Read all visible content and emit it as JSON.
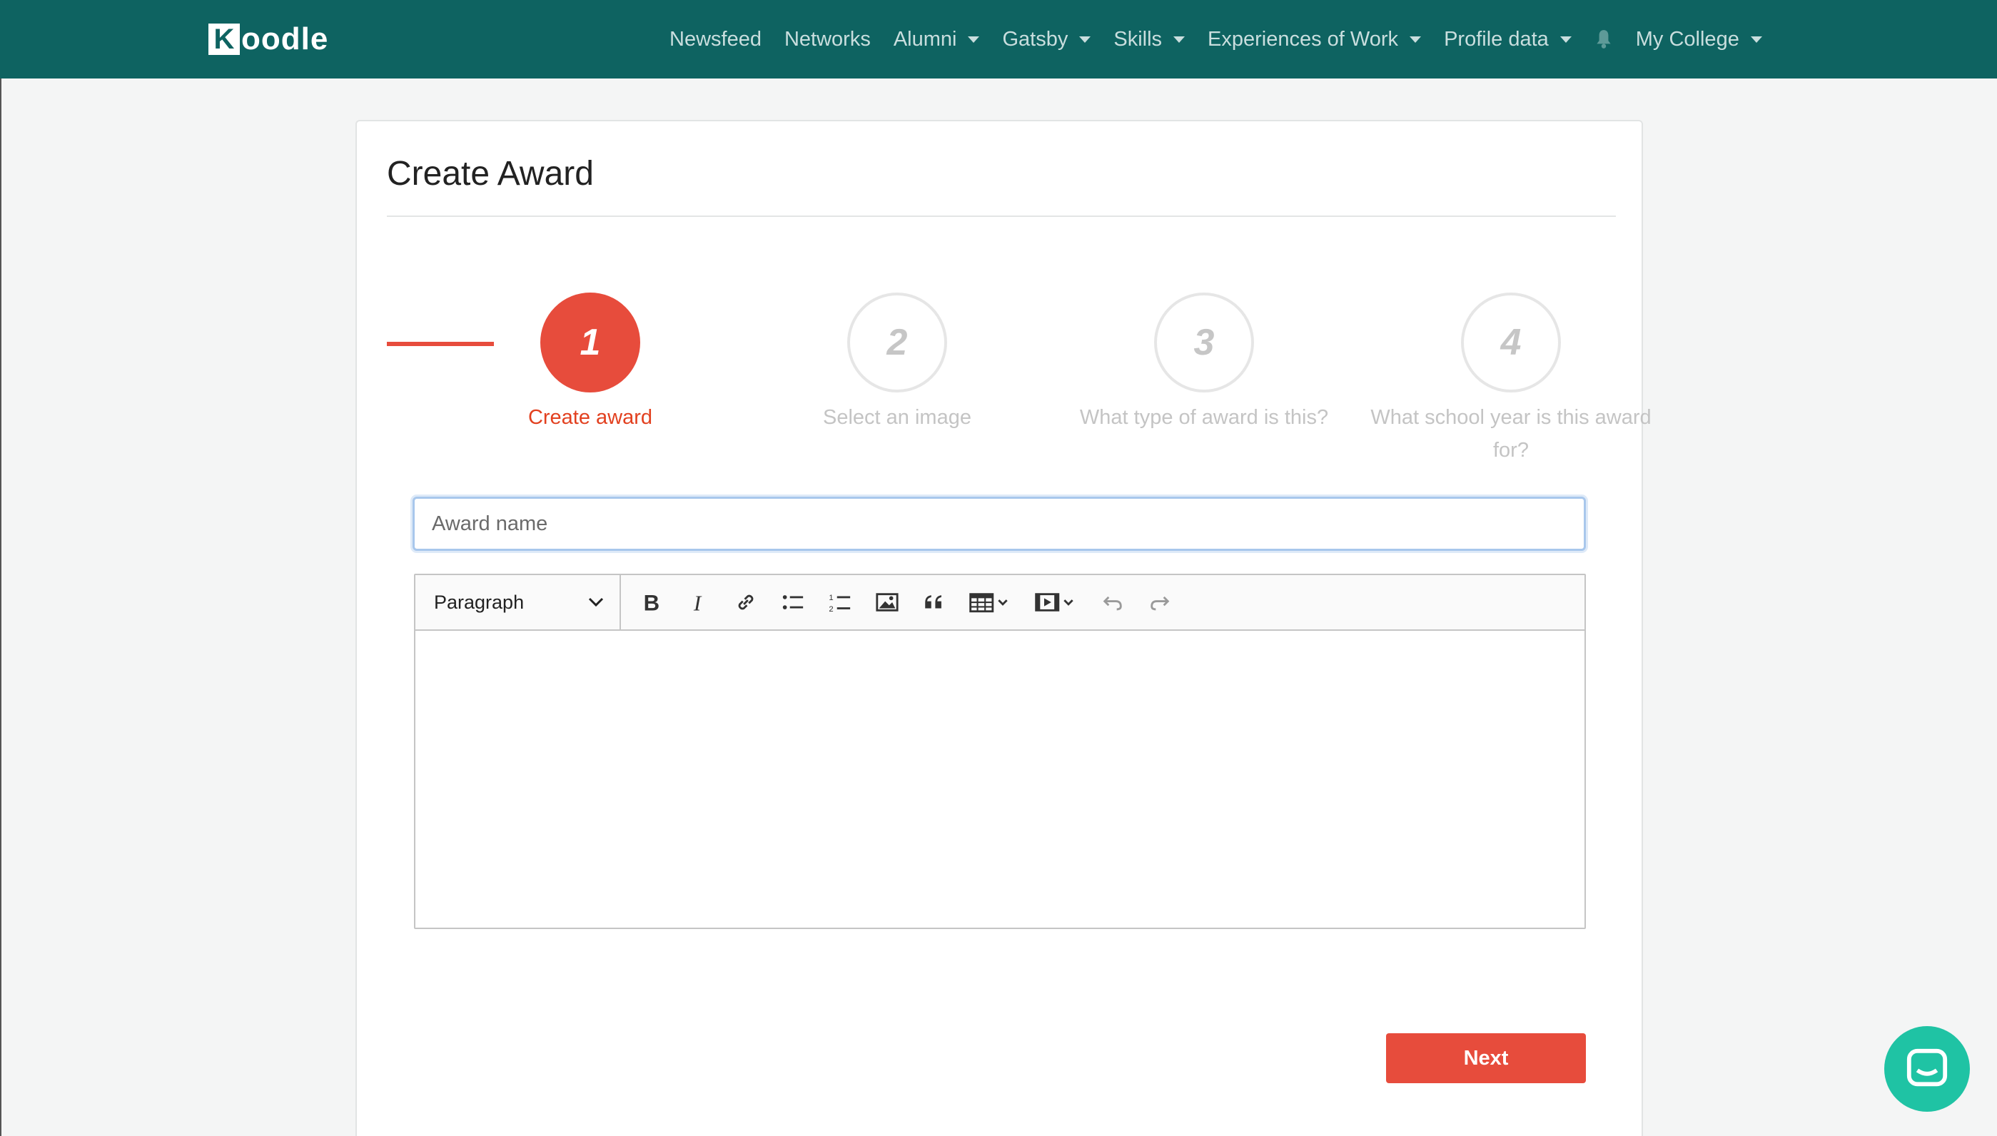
{
  "navbar": {
    "logo_letter": "K",
    "logo_rest": "oodle",
    "items": [
      {
        "label": "Newsfeed",
        "dropdown": false
      },
      {
        "label": "Networks",
        "dropdown": false
      },
      {
        "label": "Alumni",
        "dropdown": true
      },
      {
        "label": "Gatsby",
        "dropdown": true
      },
      {
        "label": "Skills",
        "dropdown": true
      },
      {
        "label": "Experiences of Work",
        "dropdown": true
      },
      {
        "label": "Profile data",
        "dropdown": true
      }
    ],
    "notifications_icon": "bell-icon",
    "college_menu": "My College"
  },
  "page": {
    "title": "Create Award"
  },
  "stepper": {
    "steps": [
      {
        "number": "1",
        "label": "Create award",
        "active": true
      },
      {
        "number": "2",
        "label": "Select an image",
        "active": false
      },
      {
        "number": "3",
        "label": "What type of award is this?",
        "active": false
      },
      {
        "number": "4",
        "label": "What school year is this award for?",
        "active": false
      }
    ]
  },
  "form": {
    "award_name_placeholder": "Award name",
    "award_name_value": ""
  },
  "editor": {
    "block_format": "Paragraph",
    "toolbar": [
      "bold-icon",
      "italic-icon",
      "link-icon",
      "bulleted-list-icon",
      "numbered-list-icon",
      "image-icon",
      "blockquote-icon",
      "table-icon",
      "media-icon",
      "undo-icon",
      "redo-icon"
    ],
    "content": ""
  },
  "actions": {
    "next_label": "Next"
  },
  "colors": {
    "navbar": "#0e6361",
    "accent": "#e74c3c",
    "chat": "#1fc3a4"
  }
}
